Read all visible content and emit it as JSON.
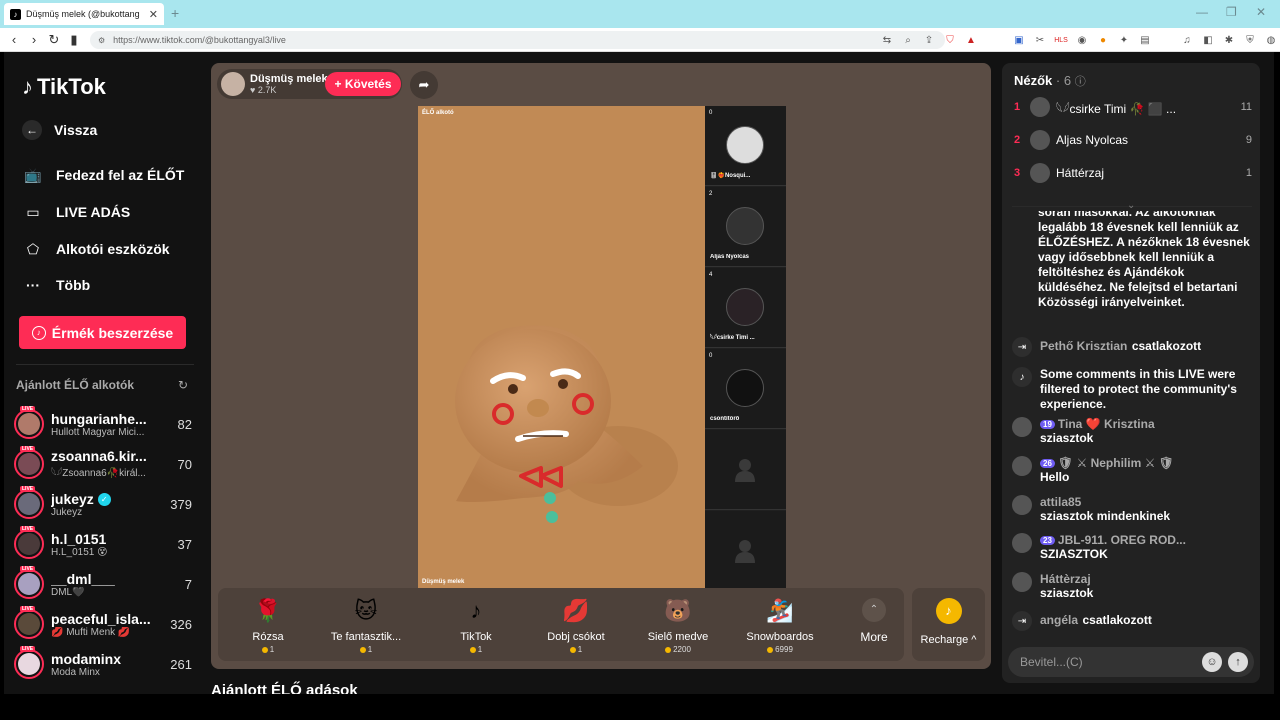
{
  "browser": {
    "tab_title": "Düşmüş melek (@bukottang",
    "url": "https://www.tiktok.com/@bukottangyal3/live"
  },
  "sidebar": {
    "logo": "TikTok",
    "back": "Vissza",
    "nav": [
      {
        "label": "Fedezd fel az ÉLŐT",
        "icon": "tv-icon"
      },
      {
        "label": "LIVE ADÁS",
        "icon": "video-camera-icon"
      },
      {
        "label": "Alkotói eszközök",
        "icon": "creator-tools-icon"
      },
      {
        "label": "Több",
        "icon": "more-dots-icon"
      }
    ],
    "coins_button": "Érmék beszerzése",
    "recommended_label": "Ajánlott ÉLŐ alkotók",
    "creators": [
      {
        "name": "hungarianhe...",
        "sub": "Hullott Magyar Mici...",
        "count": "82",
        "color": "#b07a6a"
      },
      {
        "name": "zsoanna6.kir...",
        "sub": "𓆩𓆪Zsoanna6🥀királ...",
        "count": "70",
        "color": "#7a4b55"
      },
      {
        "name": "jukeyz",
        "sub": "Jukeyz",
        "count": "379",
        "color": "#6a6a7a",
        "verified": true
      },
      {
        "name": "h.l_0151",
        "sub": "H.L_0151 😵",
        "count": "37",
        "color": "#4a3a3a"
      },
      {
        "name": "__dml___",
        "sub": "DML🖤",
        "count": "7",
        "color": "#a8a0c0"
      },
      {
        "name": "peaceful_isla...",
        "sub": "💋 Mufti Menk 💋",
        "count": "326",
        "color": "#5a4a3a"
      },
      {
        "name": "modaminx",
        "sub": "Moda Minx",
        "count": "261",
        "color": "#e8d8e0"
      }
    ],
    "live_badge": "LIVE"
  },
  "stage": {
    "host_name": "Düşmüş melek",
    "host_likes": "♥ 2.7K",
    "follow": "+ Követés",
    "main_label": "ÉLŐ alkotó",
    "main_host": "Düşmüş melek",
    "guests": [
      {
        "count": "0",
        "name": "🎚️❤️‍🔥Nosqui...",
        "color": "#ddd"
      },
      {
        "count": "2",
        "name": "Aljas Nyolcas",
        "color": "#333"
      },
      {
        "count": "4",
        "name": "𓆩𓆪csirke Timi ...",
        "color": "#2a2226"
      },
      {
        "count": "0",
        "name": "csontitörő",
        "color": "#111"
      }
    ],
    "gifts": [
      {
        "name": "Rózsa",
        "price": "1",
        "emoji": "🌹"
      },
      {
        "name": "Te fantasztik...",
        "price": "1",
        "emoji": "🐱"
      },
      {
        "name": "TikTok",
        "price": "1",
        "emoji": "♪"
      },
      {
        "name": "Dobj csókot",
        "price": "1",
        "emoji": "💋"
      },
      {
        "name": "Sielő medve",
        "price": "2200",
        "emoji": "🐻"
      },
      {
        "name": "Snowboardos",
        "price": "6999",
        "emoji": "🏂"
      }
    ],
    "more": "More",
    "recharge": "Recharge ^",
    "recommended_streams": "Ajánlott ÉLŐ adások"
  },
  "panel": {
    "viewers_title": "Nézők",
    "viewers_count": "· 6",
    "viewers": [
      {
        "rank": "1",
        "name": "𓆩𓆪csirke Timi 🥀 ⬛ ...",
        "score": "11"
      },
      {
        "rank": "2",
        "name": "Aljas Nyolcas",
        "score": "9"
      },
      {
        "rank": "3",
        "name": "Háttérzaj",
        "score": "1"
      }
    ],
    "notice": "során másokkal. Az alkotóknak legalább 18 évesnek kell lenniük az ÉLŐZÉSHEZ. A nézőknek 18 évesnek vagy idősebbnek kell lenniük a feltöltéshez és Ajándékok küldéséhez. Ne felejtsd el betartani Közösségi irányelveinket.",
    "messages": [
      {
        "type": "join",
        "user": "Pethő Krisztian",
        "text": "csatlakozott"
      },
      {
        "type": "system",
        "text": "Some comments in this LIVE were filtered to protect the community's experience."
      },
      {
        "type": "chat",
        "level": "19",
        "user": "Tina ❤️ Krisztina",
        "text": "szia​sztok"
      },
      {
        "type": "chat",
        "level": "26",
        "user": "🛡 ⚔ Nephilim ⚔ 🛡",
        "text": "Hello"
      },
      {
        "type": "chat",
        "level": "",
        "user": "attila85",
        "text": "sziasztok mindenkinek"
      },
      {
        "type": "chat",
        "level": "23",
        "user": "JBL-911. OREG ROD...",
        "text": "SZIASZTOK"
      },
      {
        "type": "chat",
        "level": "",
        "user": "Háttèrzaj",
        "text": "sziasztok"
      },
      {
        "type": "join",
        "user": "angéla",
        "text": "csatlakozott"
      }
    ],
    "input_placeholder": "Bevitel...(C)"
  }
}
